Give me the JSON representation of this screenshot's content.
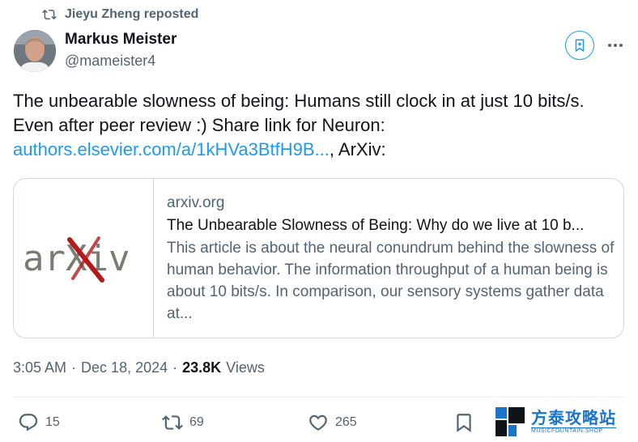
{
  "repost": {
    "label": "Jieyu Zheng reposted",
    "icon": "repost-icon"
  },
  "author": {
    "name": "Markus Meister",
    "handle": "@mameister4"
  },
  "tweet": {
    "line1": "The unbearable slowness of being: Humans still clock in at just 10 bits/s.",
    "line2": "Even after peer review :) Share link for Neuron:",
    "link": "authors.elsevier.com/a/1kHVa3BtfH9B...",
    "after_link": ", ArXiv:"
  },
  "card": {
    "domain": "arxiv.org",
    "title": "The Unbearable Slowness of Being: Why do we live at 10 b...",
    "description": "This article is about the neural conundrum behind the slowness of human behavior. The information throughput of a human being is about 10 bits/s. In comparison, our sensory systems gather data at...",
    "thumb_logo": "arXiv"
  },
  "meta": {
    "time": "3:05 AM",
    "sep1": "·",
    "date": "Dec 18, 2024",
    "sep2": "·",
    "views_count": "23.8K",
    "views_label": "Views"
  },
  "actions": {
    "replies": "15",
    "reposts": "69",
    "likes": "265"
  },
  "watermark": {
    "cn": "方泰攻略站",
    "en": "MUSICFOUNTAIN.SHOP"
  },
  "colors": {
    "accent": "#1d9bf0",
    "muted": "#536471",
    "text": "#0f1419",
    "border": "#cfd9de"
  }
}
